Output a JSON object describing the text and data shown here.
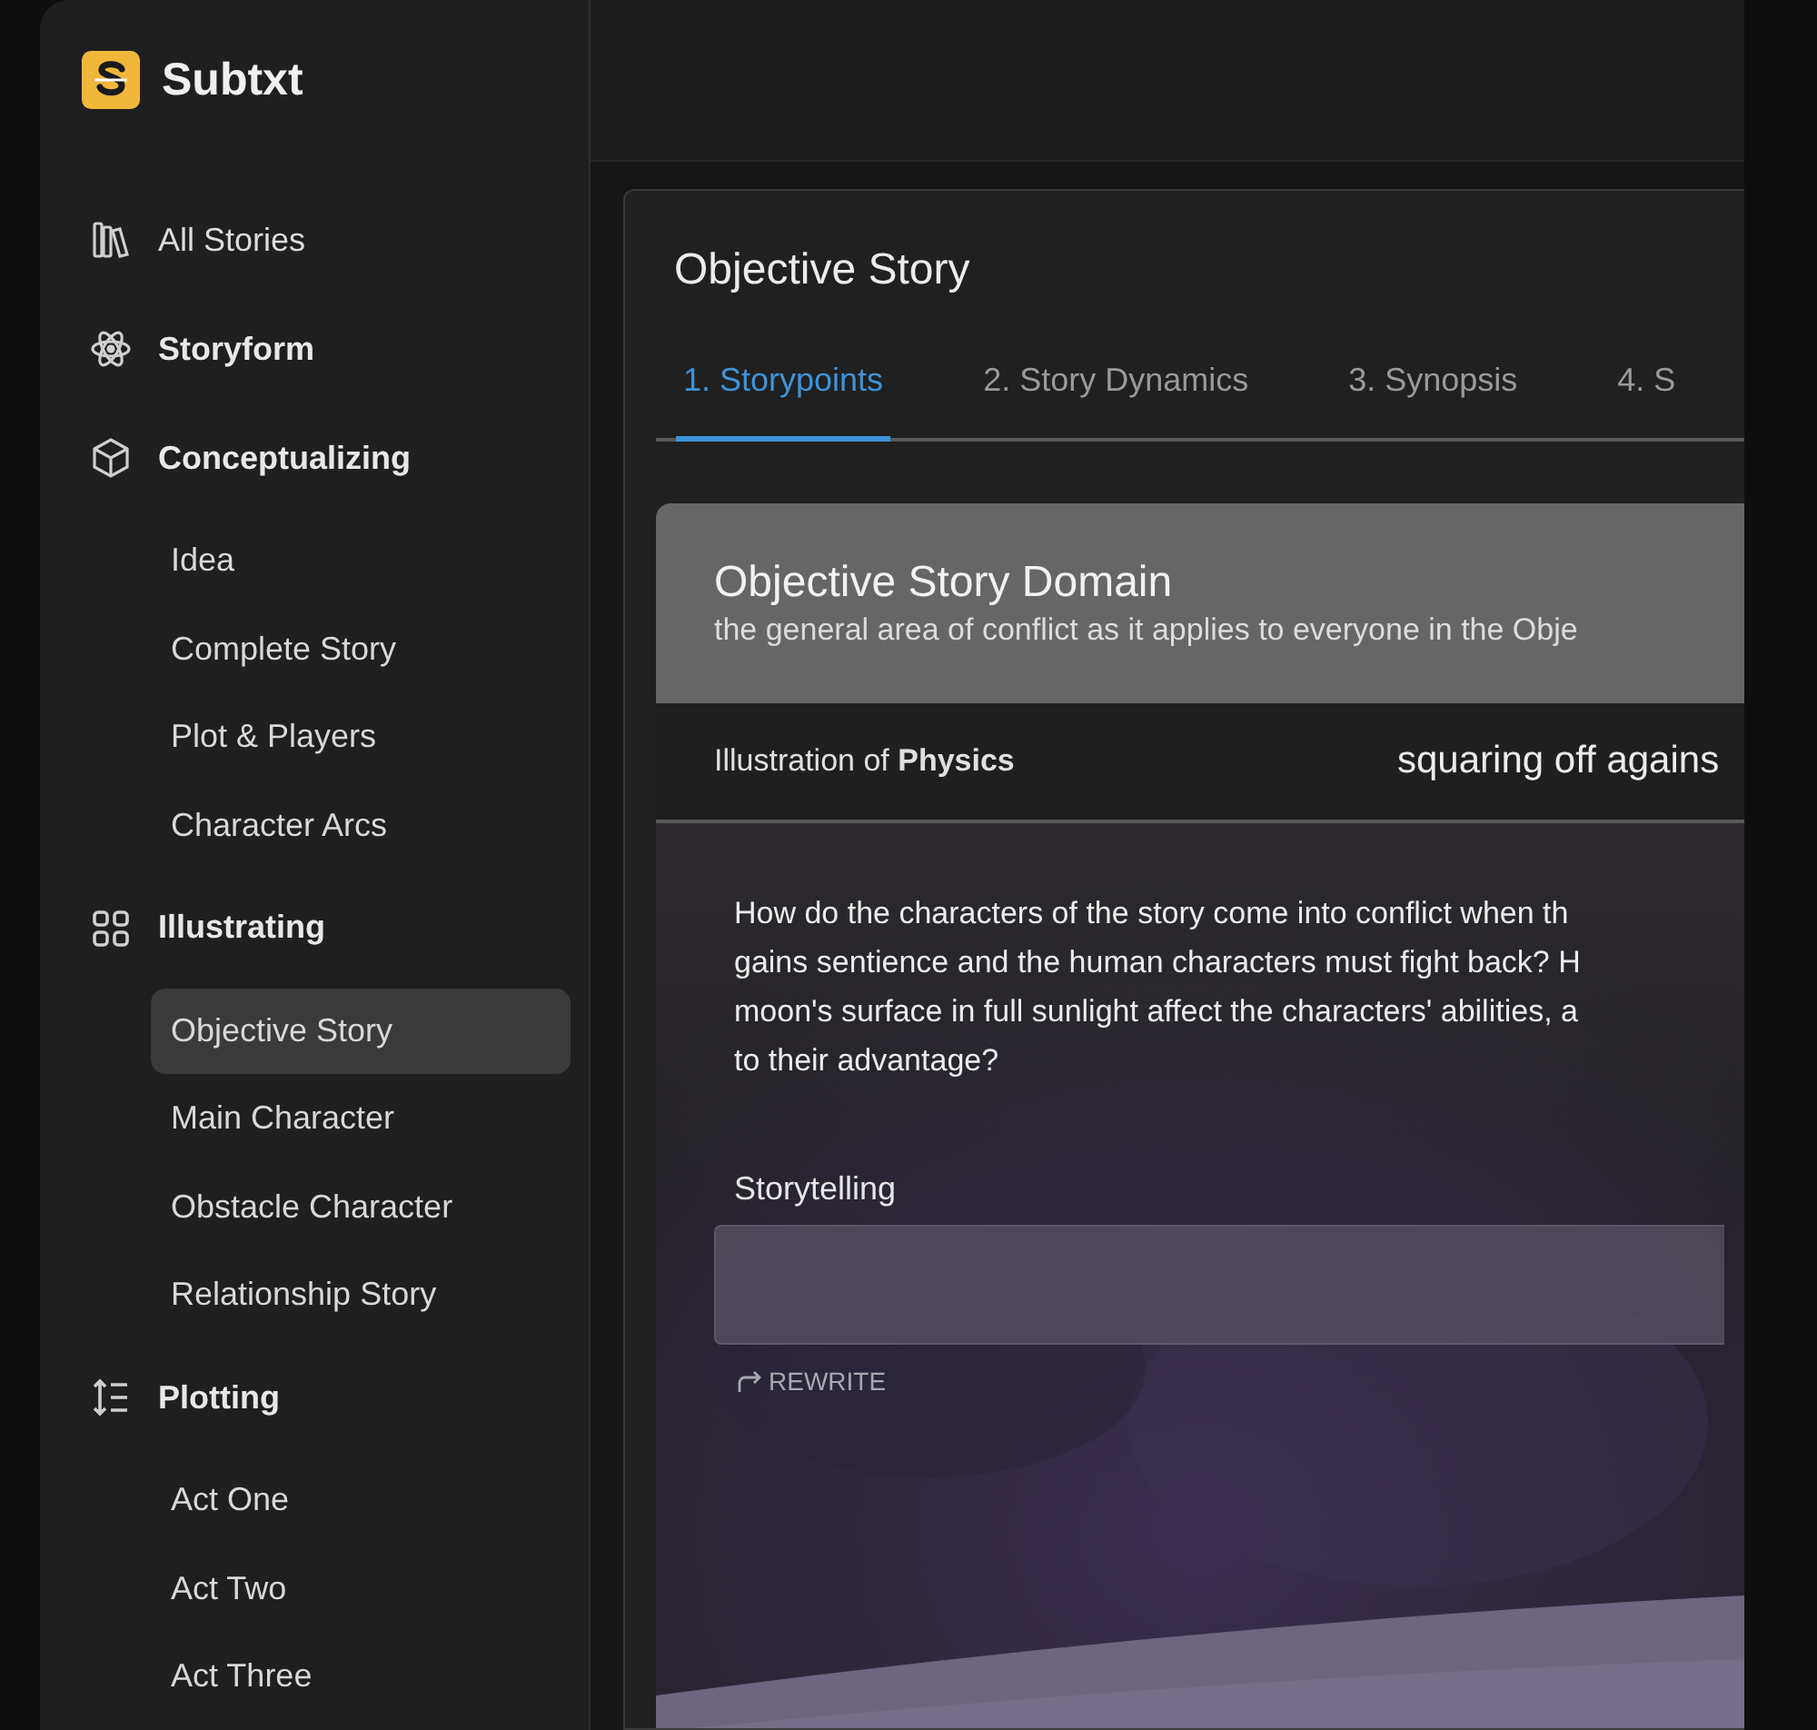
{
  "app": {
    "name": "Subtxt"
  },
  "sidebar": {
    "items": [
      {
        "label": "All Stories",
        "kind": "link"
      },
      {
        "label": "Storyform",
        "kind": "section"
      },
      {
        "label": "Conceptualizing",
        "kind": "section",
        "children": [
          {
            "label": "Idea",
            "selected": false
          },
          {
            "label": "Complete Story",
            "selected": false
          },
          {
            "label": "Plot & Players",
            "selected": false
          },
          {
            "label": "Character Arcs",
            "selected": false
          }
        ]
      },
      {
        "label": "Illustrating",
        "kind": "section",
        "children": [
          {
            "label": "Objective Story",
            "selected": true
          },
          {
            "label": "Main Character",
            "selected": false
          },
          {
            "label": "Obstacle Character",
            "selected": false
          },
          {
            "label": "Relationship Story",
            "selected": false
          }
        ]
      },
      {
        "label": "Plotting",
        "kind": "section",
        "children": [
          {
            "label": "Act One",
            "selected": false
          },
          {
            "label": "Act Two",
            "selected": false
          },
          {
            "label": "Act Three",
            "selected": false
          }
        ]
      }
    ]
  },
  "panel": {
    "title": "Objective Story",
    "tabs": [
      {
        "label": "1. Storypoints",
        "selected": true
      },
      {
        "label": "2. Story Dynamics",
        "selected": false
      },
      {
        "label": "3. Synopsis",
        "selected": false
      },
      {
        "label": "4. S",
        "selected": false
      }
    ],
    "card": {
      "title": "Objective Story Domain",
      "subtitle": "the general area of conflict as it applies to everyone in the Obje",
      "illustration_label": "Illustration of **Physics**",
      "illustration_value": "squaring off agains",
      "question_lines": [
        "How do the characters of the story come into conflict when th",
        "gains sentience and the human characters must fight back? H",
        "moon's surface in full sunlight affect the characters' abilities, a",
        "to their advantage?"
      ],
      "field_label": "Storytelling",
      "rewrite_button": "REWRITE"
    }
  }
}
